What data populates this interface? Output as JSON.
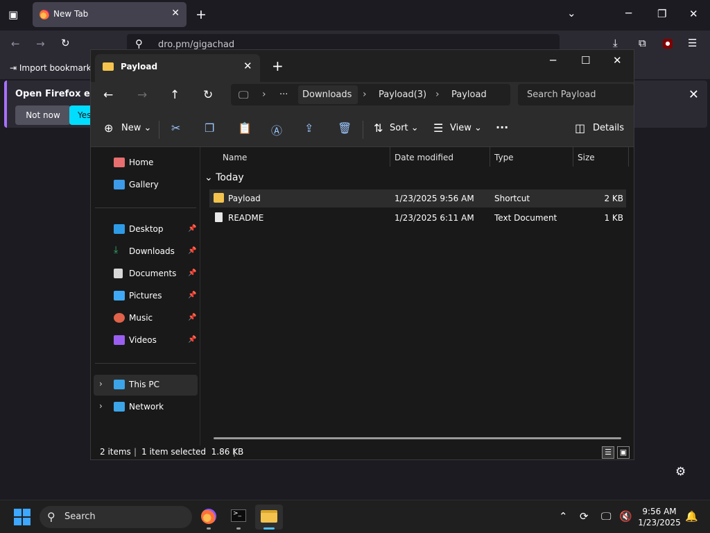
{
  "firefox": {
    "tab_title": "New Tab",
    "url": "dro.pm/gigachad",
    "bookmark": "Import bookmarks",
    "notice": {
      "message": "Open Firefox every",
      "not_now": "Not now",
      "yes": "Yes,"
    }
  },
  "explorer": {
    "tab_title": "Payload",
    "breadcrumb": {
      "ellipsis": "···",
      "segments": [
        "Downloads",
        "Payload(3)",
        "Payload"
      ]
    },
    "search_placeholder": "Search Payload",
    "commands": {
      "new": "New",
      "sort": "Sort",
      "view": "View",
      "more": "···",
      "details": "Details"
    },
    "sidebar": {
      "top": [
        {
          "label": "Home",
          "color": "#e86f6f"
        },
        {
          "label": "Gallery",
          "color": "#3c9ae8"
        }
      ],
      "pinned": [
        {
          "label": "Desktop",
          "color": "#2e9be6"
        },
        {
          "label": "Downloads",
          "color": "#2fb66c"
        },
        {
          "label": "Documents",
          "color": "#d8d8d8"
        },
        {
          "label": "Pictures",
          "color": "#3fa9f5"
        },
        {
          "label": "Music",
          "color": "#e0624a"
        },
        {
          "label": "Videos",
          "color": "#9a5ff0"
        }
      ],
      "bottom": [
        {
          "label": "This PC",
          "color": "#3ba5e8"
        },
        {
          "label": "Network",
          "color": "#3ba5e8"
        }
      ]
    },
    "columns": [
      "Name",
      "Date modified",
      "Type",
      "Size"
    ],
    "group": "Today",
    "rows": [
      {
        "name": "Payload",
        "date": "1/23/2025 9:56 AM",
        "type": "Shortcut",
        "size": "2 KB",
        "icon": "folder-shortcut-icon"
      },
      {
        "name": "README",
        "date": "1/23/2025 6:11 AM",
        "type": "Text Document",
        "size": "1 KB",
        "icon": "text-file-icon"
      }
    ],
    "status": {
      "items": "2 items",
      "selected": "1 item selected  1.86 KB"
    }
  },
  "taskbar": {
    "search_placeholder": "Search",
    "time": "9:56 AM",
    "date": "1/23/2025"
  }
}
